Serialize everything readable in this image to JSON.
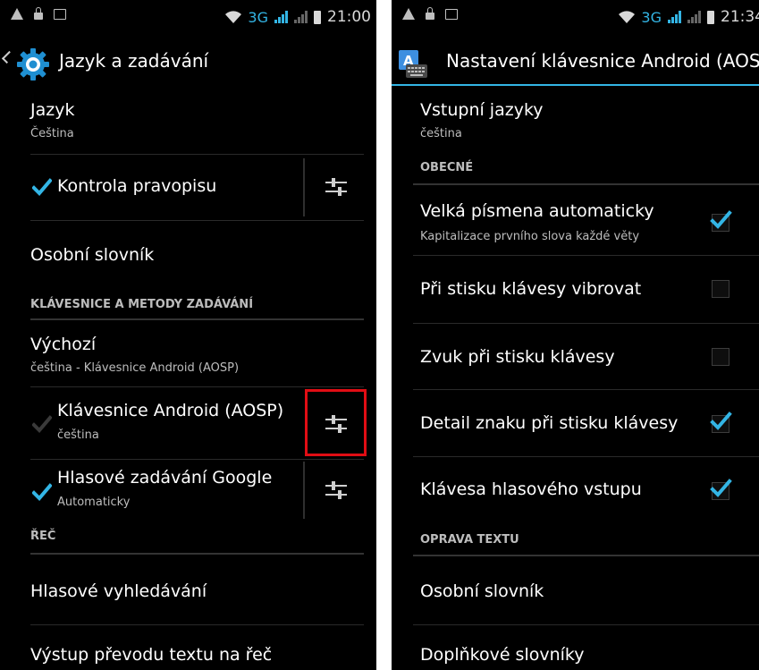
{
  "left": {
    "status": {
      "network": "3G",
      "time": "21:00"
    },
    "title": "Jazyk a zadávání",
    "rows": {
      "language": {
        "title": "Jazyk",
        "summary": "Čeština"
      },
      "spellcheck": {
        "title": "Kontrola pravopisu",
        "checked": true
      },
      "dictionary": {
        "title": "Osobní slovník"
      }
    },
    "section_keyboards": "KLÁVESNICE A METODY ZADÁVÁNÍ",
    "keyboards": {
      "default": {
        "title": "Výchozí",
        "summary": "čeština - Klávesnice Android (AOSP)"
      },
      "aosp": {
        "title": "Klávesnice Android (AOSP)",
        "summary": "čeština",
        "checked": true,
        "disabled": true
      },
      "google_voice": {
        "title": "Hlasové zadávání Google",
        "summary": "Automaticky",
        "checked": true
      }
    },
    "section_speech": "ŘEČ",
    "speech": {
      "voice_search": {
        "title": "Hlasové vyhledávání"
      },
      "tts": {
        "title": "Výstup převodu textu na řeč"
      }
    }
  },
  "right": {
    "status": {
      "network": "3G",
      "time": "21:34"
    },
    "title": "Nastavení klávesnice Android (AOSP)",
    "rows": {
      "input_langs": {
        "title": "Vstupní jazyky",
        "summary": "čeština"
      }
    },
    "section_general": "OBECNÉ",
    "general": {
      "auto_caps": {
        "title": "Velká písmena automaticky",
        "summary": "Kapitalizace prvního slova každé věty",
        "checked": true
      },
      "vibrate": {
        "title": "Při stisku klávesy vibrovat",
        "checked": false
      },
      "sound": {
        "title": "Zvuk při stisku klávesy",
        "checked": false
      },
      "popup": {
        "title": "Detail znaku při stisku klávesy",
        "checked": true
      },
      "voice_key": {
        "title": "Klávesa hlasového vstupu",
        "checked": true
      }
    },
    "section_correction": "OPRAVA TEXTU",
    "correction": {
      "dictionary": {
        "title": "Osobní slovník"
      },
      "addon": {
        "title": "Doplňkové slovníky"
      }
    }
  },
  "colors": {
    "accent": "#33b5e5",
    "highlight": "#e10d14",
    "background": "#000000"
  },
  "icons": [
    "settings-gear-icon",
    "keyboard-icon",
    "settings-sliders-icon",
    "checkbox-icon"
  ]
}
